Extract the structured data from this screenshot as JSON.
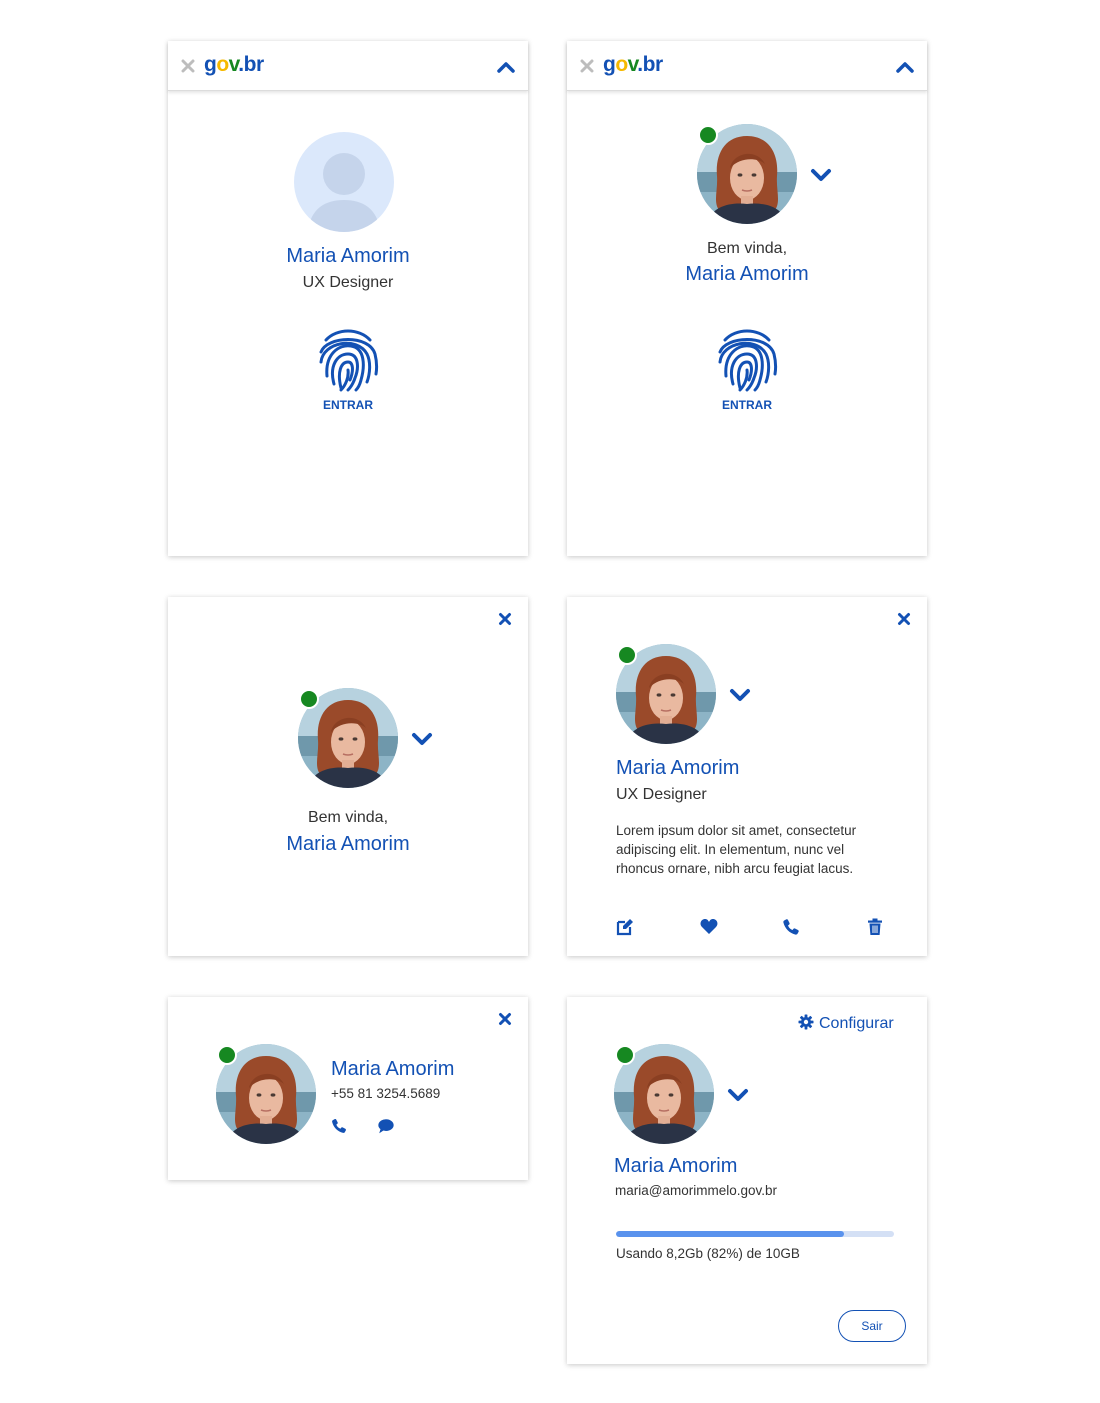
{
  "brand": {
    "logo_text": "gov.br"
  },
  "user": {
    "name": "Maria Amorim",
    "role": "UX Designer",
    "phone": "+55 81 3254.5689",
    "email": "maria@amorimmelo.gov.br",
    "status": "online"
  },
  "colors": {
    "primary": "#1351b4",
    "online": "#168821",
    "avatar_placeholder_bg": "#dbe8fb",
    "avatar_placeholder_fg": "#c5d4eb",
    "progress": "#5992ed"
  },
  "cards": {
    "login_anon": {
      "name": "Maria Amorim",
      "role": "UX Designer",
      "entrar_label": "ENTRAR"
    },
    "login_known": {
      "greeting": "Bem vinda,",
      "name": "Maria Amorim",
      "entrar_label": "ENTRAR"
    },
    "welcome": {
      "greeting": "Bem vinda,",
      "name": "Maria Amorim"
    },
    "profile": {
      "name": "Maria Amorim",
      "role": "UX Designer",
      "description": "Lorem ipsum dolor sit amet, consectetur adipiscing elit. In elementum, nunc vel rhoncus ornare, nibh arcu feugiat lacus.",
      "actions": [
        "edit-icon",
        "heart-icon",
        "phone-icon",
        "trash-icon"
      ]
    },
    "contact": {
      "name": "Maria Amorim",
      "phone": "+55 81 3254.5689",
      "actions": [
        "phone-icon",
        "chat-icon"
      ]
    },
    "account": {
      "config_label": "Configurar",
      "name": "Maria Amorim",
      "email": "maria@amorimmelo.gov.br",
      "storage_text": "Usando 8,2Gb (82%) de 10GB",
      "storage_fraction": 0.82,
      "logout_label": "Sair"
    }
  }
}
